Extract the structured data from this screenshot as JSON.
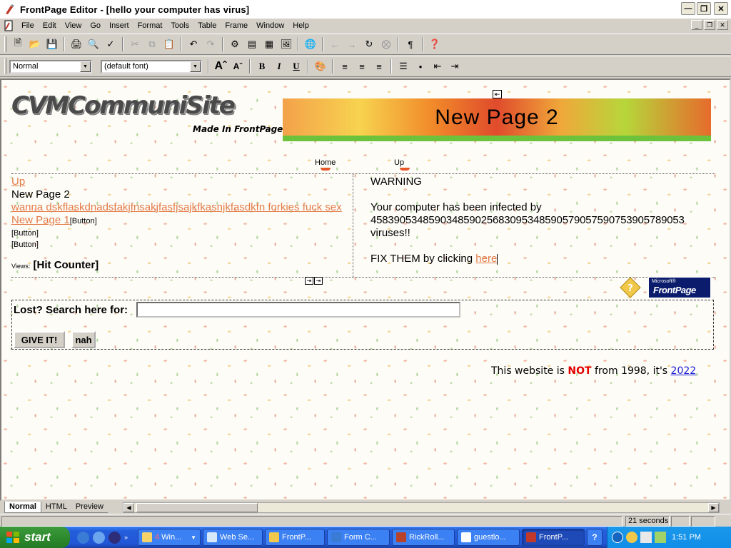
{
  "window": {
    "title": "FrontPage Editor - [hello your computer has virus]"
  },
  "menu": [
    "File",
    "Edit",
    "View",
    "Go",
    "Insert",
    "Format",
    "Tools",
    "Table",
    "Frame",
    "Window",
    "Help"
  ],
  "toolbar": {
    "style_value": "Normal",
    "font_value": "(default font)"
  },
  "page": {
    "logo_text": "CVMCommuniSite",
    "made_in_text": "Made In FrontPage",
    "banner_title": "New Page 2",
    "nav": {
      "home": "Home",
      "up": "Up"
    },
    "left": {
      "up_link": "Up",
      "current_page": "New Page 2",
      "wanna_link": "wanna dskflaskdnadsfakjfnsakjfasfjsajkfkasnjkfasdkfn forkies fuck sex",
      "page1_link": "New Page 1",
      "button_placeholder_1": "[Button]",
      "button_placeholder_2": "[Button]",
      "button_placeholder_3": "[Button]",
      "views_label": "Views:",
      "hit_counter": "[Hit Counter]"
    },
    "right": {
      "warning": "WARNING",
      "infected_line1": "Your computer has been infected by",
      "infected_number": "458390534859034859025683095348590579057590753905789053",
      "infected_line3": "viruses!!",
      "fix_text": "FIX THEM by clicking ",
      "fix_link": "here"
    },
    "fp_badge": {
      "microsoft": "Microsoft®",
      "frontpage": "FrontPage"
    },
    "search": {
      "label": "Lost? Search here for:",
      "value": "",
      "submit_label": "GIVE IT!",
      "reset_label": "nah"
    },
    "footer": {
      "prefix": "This website is ",
      "not": "NOT",
      "middle": " from 1998, it's ",
      "year": "2022"
    }
  },
  "view_tabs": [
    "Normal",
    "HTML",
    "Preview"
  ],
  "status": {
    "time_estimate": "21 seconds"
  },
  "taskbar": {
    "start_label": "start",
    "tasks": [
      {
        "label": "Win...",
        "count": "4"
      },
      {
        "label": "Web Se..."
      },
      {
        "label": "FrontP..."
      },
      {
        "label": "Form C..."
      },
      {
        "label": "RickRoll..."
      },
      {
        "label": "guestlo..."
      },
      {
        "label": "FrontP..."
      }
    ],
    "clock": "1:51 PM"
  },
  "colors": {
    "link": "#e37b47",
    "warning_not": "#e20000",
    "year_link": "#1a1ad6",
    "taskbar": "#245edb",
    "start_button": "#2e8b2e"
  }
}
